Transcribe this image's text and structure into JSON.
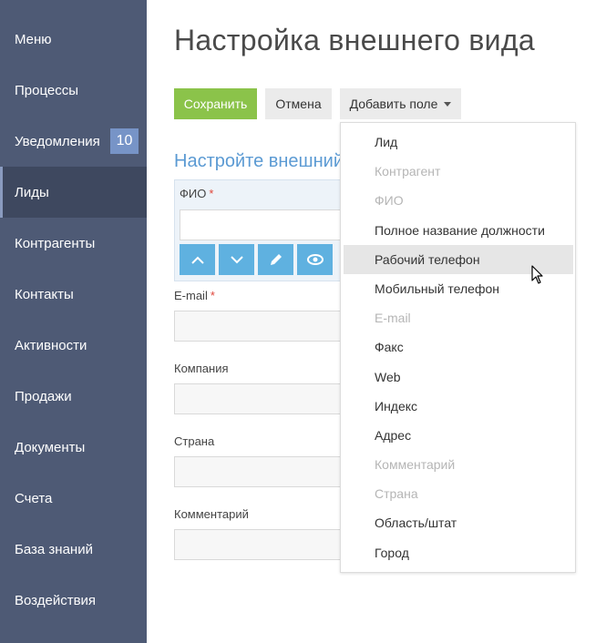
{
  "sidebar": {
    "items": [
      {
        "label": "Меню"
      },
      {
        "label": "Процессы"
      },
      {
        "label": "Уведомления",
        "badge": "10"
      },
      {
        "label": "Лиды",
        "active": true
      },
      {
        "label": "Контрагенты"
      },
      {
        "label": "Контакты"
      },
      {
        "label": "Активности"
      },
      {
        "label": "Продажи"
      },
      {
        "label": "Документы"
      },
      {
        "label": "Счета"
      },
      {
        "label": "База знаний"
      },
      {
        "label": "Воздействия"
      }
    ]
  },
  "header": {
    "title": "Настройка внешнего вида"
  },
  "toolbar": {
    "save_label": "Сохранить",
    "cancel_label": "Отмена",
    "add_field_label": "Добавить поле"
  },
  "form": {
    "section_title": "Настройте внешний вид",
    "fields": [
      {
        "label": "ФИО",
        "required": "*"
      },
      {
        "label": "E-mail",
        "required": "*"
      },
      {
        "label": "Компания"
      },
      {
        "label": "Страна"
      },
      {
        "label": "Комментарий"
      }
    ],
    "tools": [
      "chevron-up-icon",
      "chevron-down-icon",
      "pencil-icon",
      "eye-icon"
    ]
  },
  "dropdown": {
    "items": [
      {
        "label": "Лид",
        "enabled": true
      },
      {
        "label": "Контрагент",
        "enabled": false
      },
      {
        "label": "ФИО",
        "enabled": false
      },
      {
        "label": "Полное название должности",
        "enabled": true
      },
      {
        "label": "Рабочий телефон",
        "enabled": true,
        "hover": true
      },
      {
        "label": "Мобильный телефон",
        "enabled": true
      },
      {
        "label": "E-mail",
        "enabled": false
      },
      {
        "label": "Факс",
        "enabled": true
      },
      {
        "label": "Web",
        "enabled": true
      },
      {
        "label": "Индекс",
        "enabled": true
      },
      {
        "label": "Адрес",
        "enabled": true
      },
      {
        "label": "Комментарий",
        "enabled": false
      },
      {
        "label": "Страна",
        "enabled": false
      },
      {
        "label": "Область/штат",
        "enabled": true
      },
      {
        "label": "Город",
        "enabled": true
      }
    ]
  },
  "colors": {
    "sidebar_bg": "#4e5a75",
    "save_button": "#8bc34a",
    "accent_blue": "#5b9ad3",
    "tool_button": "#5fb1e0",
    "required": "#e0453a"
  }
}
